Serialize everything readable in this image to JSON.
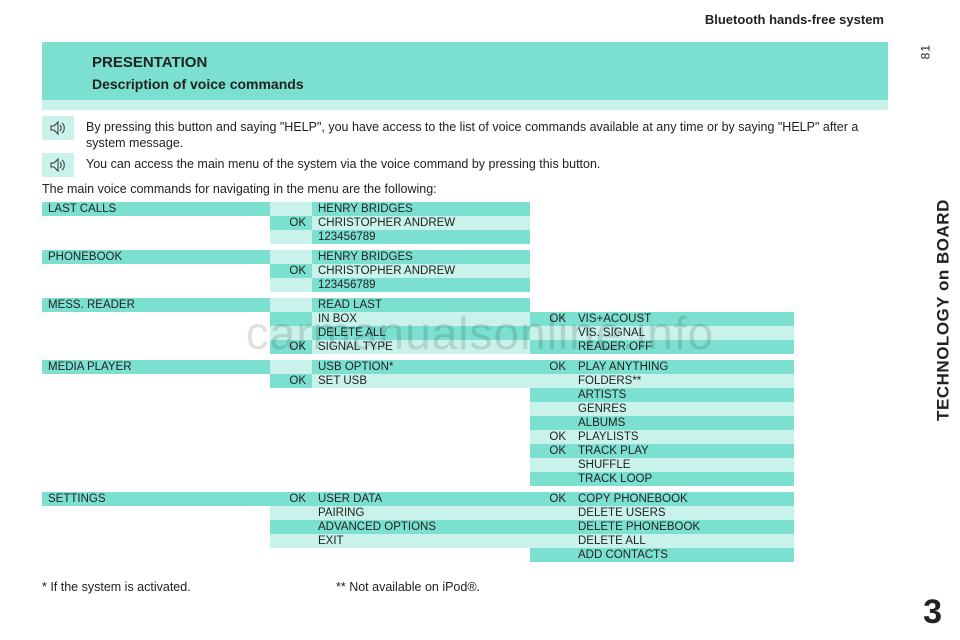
{
  "header_right": "Bluetooth hands-free system",
  "page_number": "81",
  "side_label": "TECHNOLOGY on BOARD",
  "chapter": "3",
  "title1": "PRESENTATION",
  "title2": "Description of voice commands",
  "intro1": "By pressing this button and saying \"HELP\", you have access to the list of voice commands available at any time or by saying \"HELP\" after a system message.",
  "intro2": "You can access the main menu of the system via the voice command by pressing this button.",
  "summary": "The main voice commands for navigating in the menu are the following:",
  "groups": {
    "lastcalls": {
      "label": "LAST CALLS",
      "ok0": "",
      "ok1": "OK",
      "ok2": "",
      "v0": "HENRY BRIDGES",
      "v1": "CHRISTOPHER ANDREW",
      "v2": "123456789"
    },
    "phonebook": {
      "label": "PHONEBOOK",
      "ok0": "",
      "ok1": "OK",
      "ok2": "",
      "v0": "HENRY BRIDGES",
      "v1": "CHRISTOPHER ANDREW",
      "v2": "123456789"
    },
    "mess": {
      "label": "MESS. READER",
      "ok0": "",
      "ok1": "",
      "ok2": "",
      "ok3": "OK",
      "v0": "READ LAST",
      "v1": "IN BOX",
      "v2": "DELETE ALL",
      "v3": "SIGNAL TYPE",
      "r_ok0": "OK",
      "r_ok1": "",
      "r_ok2": "",
      "r0": "VIS+ACOUST",
      "r1": "VIS. SIGNAL",
      "r2": "READER OFF"
    },
    "media": {
      "label": "MEDIA PLAYER",
      "ok0": "",
      "ok1": "OK",
      "v0": "USB OPTION*",
      "v1": "SET USB",
      "r_ok0": "OK",
      "r_ok1": "",
      "r_ok2": "",
      "r_ok3": "",
      "r_ok4": "",
      "r_ok5": "OK",
      "r_ok6": "",
      "r_ok7": "",
      "r0": "PLAY ANYTHING",
      "r1": "FOLDERS**",
      "r2": "ARTISTS",
      "r3": "GENRES",
      "r4": "ALBUMS",
      "r5": "PLAYLISTS",
      "r6": "TRACK PLAY",
      "r7": "SHUFFLE",
      "r8": "TRACK LOOP"
    },
    "settings": {
      "label": "SETTINGS",
      "ok0": "OK",
      "ok1": "",
      "ok2": "",
      "ok3": "",
      "v0": "USER DATA",
      "v1": "PAIRING",
      "v2": "ADVANCED OPTIONS",
      "v3": "EXIT",
      "r_ok0": "OK",
      "r_ok1": "",
      "r_ok2": "",
      "r_ok3": "",
      "r_ok4": "",
      "r0": "COPY PHONEBOOK",
      "r1": "DELETE USERS",
      "r2": "DELETE PHONEBOOK",
      "r3": "DELETE ALL",
      "r4": "ADD CONTACTS"
    }
  },
  "footnote1": "* If the system is activated.",
  "footnote2": "** Not available on iPod®.",
  "watermark": "carmanualsonline.info"
}
